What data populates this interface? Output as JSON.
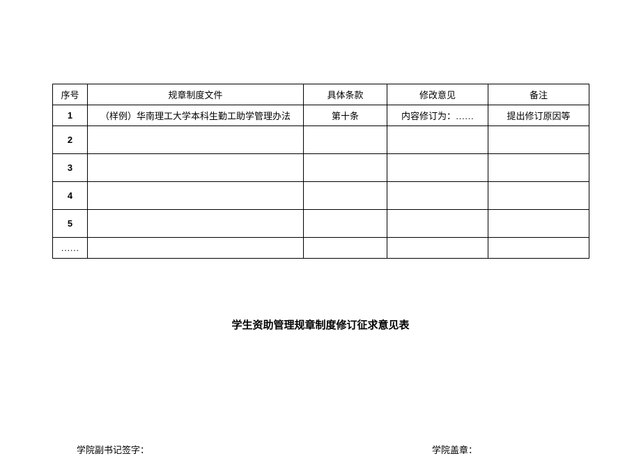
{
  "table": {
    "headers": {
      "seq": "序号",
      "doc": "规章制度文件",
      "clause": "具体条款",
      "opinion": "修改意见",
      "remark": "备注"
    },
    "rows": [
      {
        "seq": "1",
        "doc": "（样例）华南理工大学本科生勤工助学管理办法",
        "clause": "第十条",
        "opinion": "内容修订为：……",
        "remark": "提出修订原因等"
      },
      {
        "seq": "2",
        "doc": "",
        "clause": "",
        "opinion": "",
        "remark": ""
      },
      {
        "seq": "3",
        "doc": "",
        "clause": "",
        "opinion": "",
        "remark": ""
      },
      {
        "seq": "4",
        "doc": "",
        "clause": "",
        "opinion": "",
        "remark": ""
      },
      {
        "seq": "5",
        "doc": "",
        "clause": "",
        "opinion": "",
        "remark": ""
      },
      {
        "seq": "……",
        "doc": "",
        "clause": "",
        "opinion": "",
        "remark": ""
      }
    ]
  },
  "title": "学生资助管理规章制度修订征求意见表",
  "signature": {
    "left": "学院副书记签字：",
    "right": "学院盖章："
  }
}
